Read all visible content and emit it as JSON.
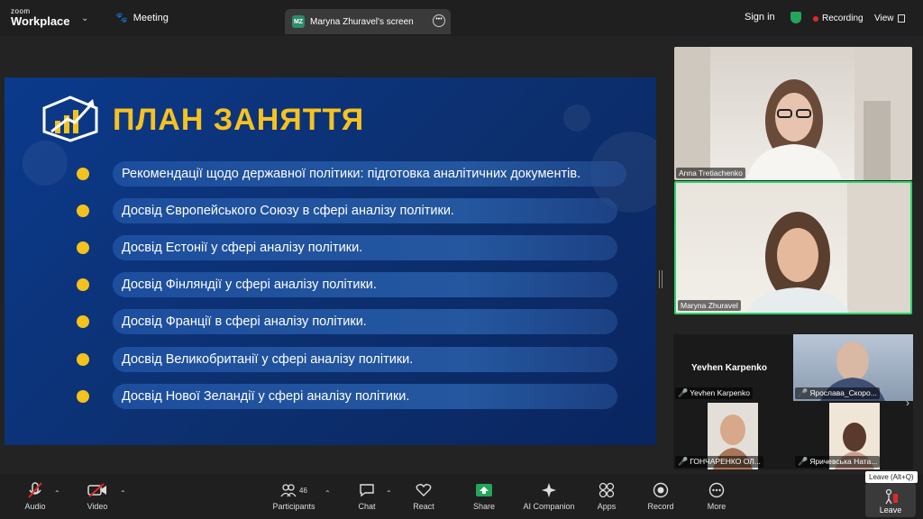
{
  "topbar": {
    "brand_small": "zoom",
    "brand": "Workplace",
    "meeting_label": "Meeting",
    "tab_initials": "MZ",
    "tab_title": "Maryna Zhuravel's screen",
    "sign_in": "Sign in",
    "recording": "Recording",
    "view": "View"
  },
  "slide": {
    "title": "ПЛАН ЗАНЯТТЯ",
    "items": [
      "Рекомендації щодо державної політики: підготовка аналітичних документів.",
      "Досвід Європейського Союзу в сфері аналізу політики.",
      "Досвід Естонії у сфері аналізу політики.",
      "Досвід Фінляндії у сфері аналізу політики.",
      "Досвід Франції в сфері аналізу політики.",
      "Досвід Великобританії у сфері аналізу політики.",
      "Досвід Нової Зеландії у сфері аналізу політики."
    ]
  },
  "participants_videos": {
    "top": "Anna Tretiachenko",
    "active": "Maryna Zhuravel",
    "gallery": [
      {
        "name": "Yevhen Karpenko",
        "caption": "Yevhen Karpenko"
      },
      {
        "name": "Ярослава_Скоро..."
      },
      {
        "name": "ГОНЧАРЕНКО ОЛ..."
      },
      {
        "name": "Яричевська Ната..."
      }
    ]
  },
  "toolbar": {
    "audio": "Audio",
    "video": "Video",
    "participants": "Participants",
    "participants_count": "46",
    "chat": "Chat",
    "react": "React",
    "share": "Share",
    "ai": "AI Companion",
    "apps": "Apps",
    "record": "Record",
    "more": "More",
    "leave": "Leave",
    "leave_tip": "Leave (Alt+Q)"
  },
  "colors": {
    "accent": "#f7c21f",
    "share": "#23a55a",
    "record_dot": "#e02828",
    "slide_bg": "#0c2f6e"
  }
}
